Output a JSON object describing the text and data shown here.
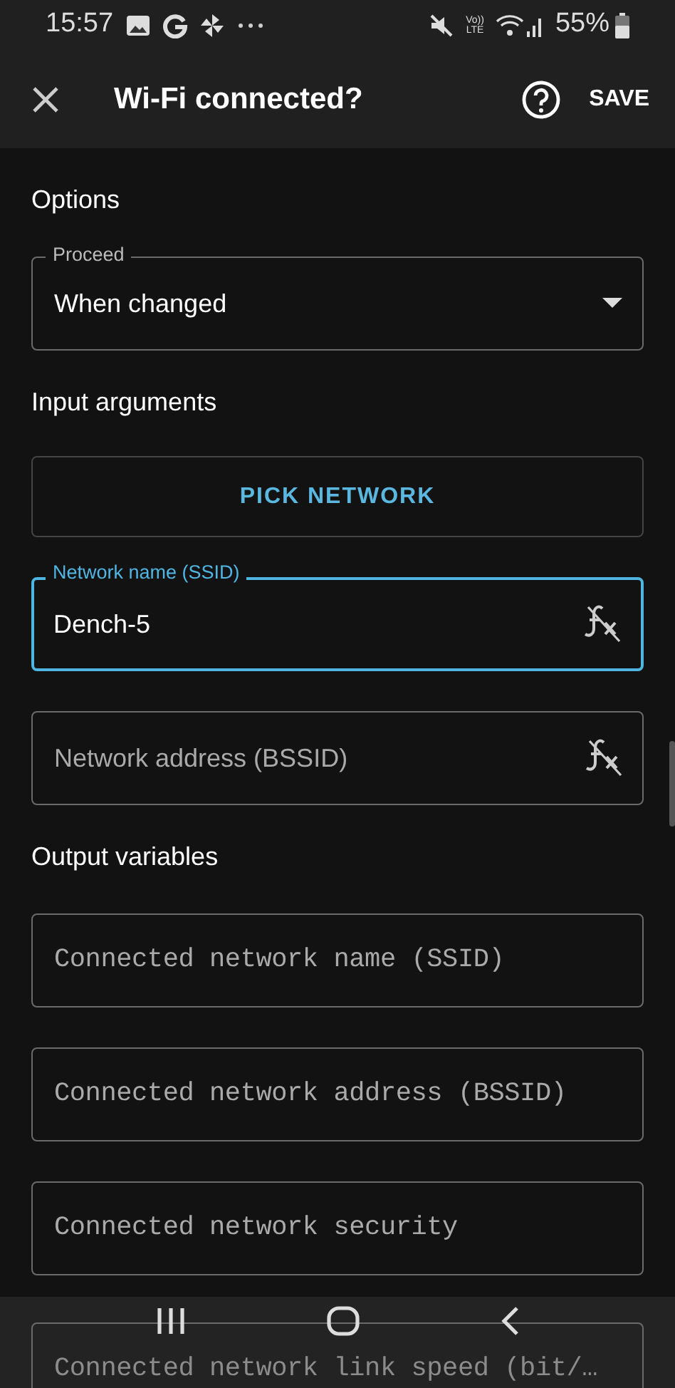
{
  "status_bar": {
    "time": "15:57",
    "volte_top": "Vo))",
    "volte_bottom": "LTE",
    "battery": "55%"
  },
  "app_bar": {
    "title": "Wi-Fi connected?",
    "action": "SAVE"
  },
  "sections": [
    {
      "heading": "Options",
      "fields": [
        {
          "kind": "dropdown",
          "label": "Proceed",
          "value": "When changed"
        }
      ]
    },
    {
      "heading": "Input arguments",
      "fields": [
        {
          "kind": "button",
          "label": "PICK NETWORK"
        },
        {
          "kind": "text",
          "label": "Network name (SSID)",
          "value": "Dench-5",
          "focused": true
        },
        {
          "kind": "text",
          "placeholder": "Network address (BSSID)",
          "focused": false
        }
      ]
    },
    {
      "heading": "Output variables",
      "fields": [
        {
          "kind": "variable",
          "placeholder": "Connected network name (SSID)"
        },
        {
          "kind": "variable",
          "placeholder": "Connected network address (BSSID)"
        },
        {
          "kind": "variable",
          "placeholder": "Connected network security"
        },
        {
          "kind": "variable",
          "placeholder": "Connected network link speed (bit/…"
        }
      ]
    }
  ]
}
